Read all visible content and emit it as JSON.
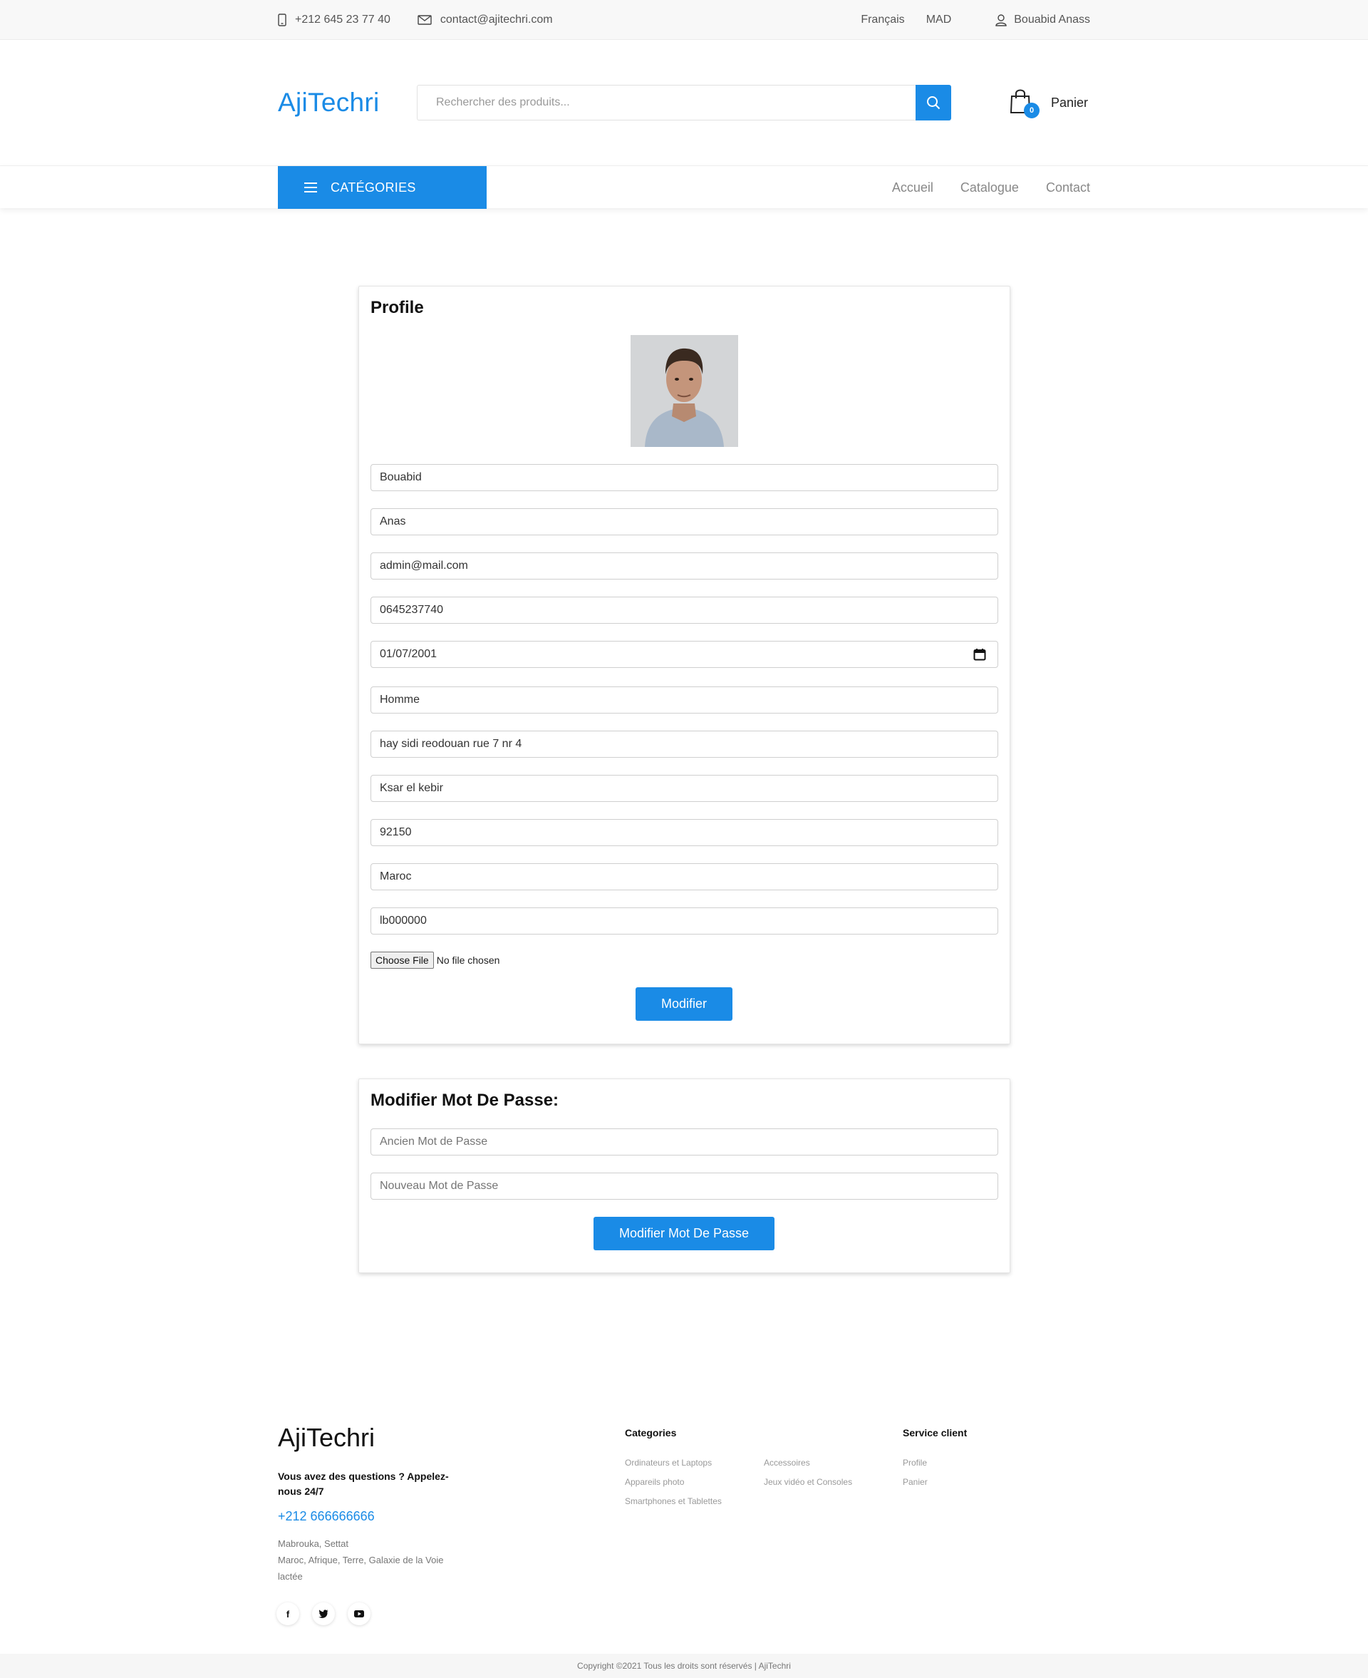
{
  "topbar": {
    "phone": "+212 645 23 77 40",
    "email": "contact@ajitechri.com",
    "language": "Français",
    "currency": "MAD",
    "user": "Bouabid Anass"
  },
  "header": {
    "logo": "AjiTechri",
    "search_placeholder": "Rechercher des produits...",
    "cart_count": "0",
    "cart_label": "Panier"
  },
  "nav": {
    "categories_label": "CATÉGORIES",
    "links": [
      "Accueil",
      "Catalogue",
      "Contact"
    ]
  },
  "profile": {
    "title": "Profile",
    "fields": {
      "last_name": "Bouabid",
      "first_name": "Anas",
      "email": "admin@mail.com",
      "phone": "0645237740",
      "birth_date": "01/07/2001",
      "gender": "Homme",
      "address": "hay sidi reodouan rue 7 nr 4",
      "city": "Ksar el kebir",
      "postal_code": "92150",
      "country": "Maroc",
      "cin": "lb000000"
    },
    "file_button": "Choose File",
    "file_status": "No file chosen",
    "submit": "Modifier"
  },
  "password": {
    "title": "Modifier Mot De Passe:",
    "old_placeholder": "Ancien Mot de Passe",
    "new_placeholder": "Nouveau Mot de Passe",
    "submit": "Modifier Mot De Passe"
  },
  "footer": {
    "logo": "AjiTechri",
    "question": "Vous avez des questions ? Appelez-nous 24/7",
    "phone": "+212 666666666",
    "address_line1": "Mabrouka, Settat",
    "address_line2": "Maroc, Afrique, Terre, Galaxie de la Voie lactée",
    "categories_title": "Categories",
    "categories": [
      "Ordinateurs et Laptops",
      "Accessoires",
      "Appareils photo",
      "Jeux vidéo et Consoles",
      "Smartphones et Tablettes"
    ],
    "service_title": "Service client",
    "service_links": [
      "Profile",
      "Panier"
    ],
    "social": [
      "f",
      "t",
      "▶"
    ],
    "copyright": "Copyright ©2021 Tous les droits sont réservés | AjiTechri"
  },
  "colors": {
    "accent": "#1a8be6"
  }
}
